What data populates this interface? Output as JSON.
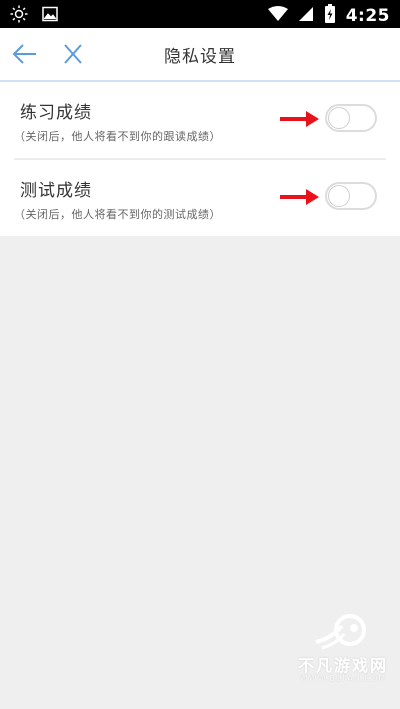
{
  "status_bar": {
    "time": "4:25",
    "icons": [
      "brightness-icon",
      "image-icon",
      "wifi-icon",
      "signal-icon",
      "battery-charging-icon"
    ]
  },
  "nav": {
    "title": "隐私设置",
    "back_icon": "arrow-left-icon",
    "close_icon": "close-icon",
    "accent_color": "#5b9bdc"
  },
  "settings": [
    {
      "title": "练习成绩",
      "description": "（关闭后，他人将看不到你的跟读成绩）",
      "enabled": false
    },
    {
      "title": "测试成绩",
      "description": "（关闭后，他人将看不到你的测试成绩）",
      "enabled": false
    }
  ],
  "annotation_color": "#e8131a",
  "watermark": {
    "text": "不凡游戏网",
    "url": "WWW.BUFAN.COM"
  }
}
